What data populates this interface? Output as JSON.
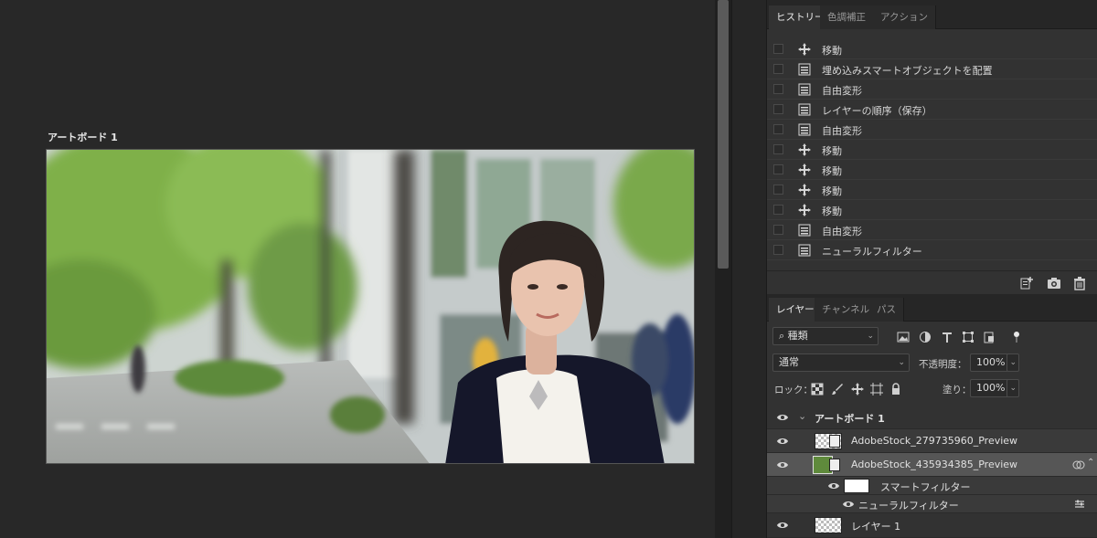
{
  "canvas": {
    "artboard_label": "アートボード 1",
    "photo": {
      "sky": "#cfd6d3",
      "foliage": "#7fb04a",
      "building": "#c9cfcf",
      "jacket": "#15172a",
      "blouse": "#f4f2ec",
      "hair": "#2d2522",
      "skin": "#e9c3ae"
    }
  },
  "history": {
    "tabs": [
      "ヒストリー",
      "色調補正",
      "アクション"
    ],
    "items": [
      {
        "icon": "move-icon",
        "label": "移動"
      },
      {
        "icon": "document-icon",
        "label": "埋め込みスマートオブジェクトを配置"
      },
      {
        "icon": "document-icon",
        "label": "自由変形"
      },
      {
        "icon": "document-icon",
        "label": "レイヤーの順序（保存）"
      },
      {
        "icon": "document-icon",
        "label": "自由変形"
      },
      {
        "icon": "move-icon",
        "label": "移動"
      },
      {
        "icon": "move-icon",
        "label": "移動"
      },
      {
        "icon": "move-icon",
        "label": "移動"
      },
      {
        "icon": "move-icon",
        "label": "移動"
      },
      {
        "icon": "document-icon",
        "label": "自由変形"
      },
      {
        "icon": "document-icon",
        "label": "ニューラルフィルター"
      }
    ]
  },
  "layers_panel": {
    "tabs": [
      "レイヤー",
      "チャンネル",
      "パス"
    ],
    "filter_kind": "種類",
    "blend_mode": "通常",
    "opacity_label": "不透明度：",
    "opacity_value": "100%",
    "lock_label": "ロック：",
    "fill_label": "塗り：",
    "fill_value": "100%",
    "layers": [
      {
        "name": "アートボード 1",
        "type": "artboard"
      },
      {
        "name": "AdobeStock_279735960_Preview",
        "type": "smart-object"
      },
      {
        "name": "AdobeStock_435934385_Preview",
        "type": "smart-object",
        "selected": true
      },
      {
        "name": "スマートフィルター",
        "type": "filter-mask"
      },
      {
        "name": "ニューラルフィルター",
        "type": "filter"
      },
      {
        "name": "レイヤー 1",
        "type": "pixel"
      }
    ]
  }
}
